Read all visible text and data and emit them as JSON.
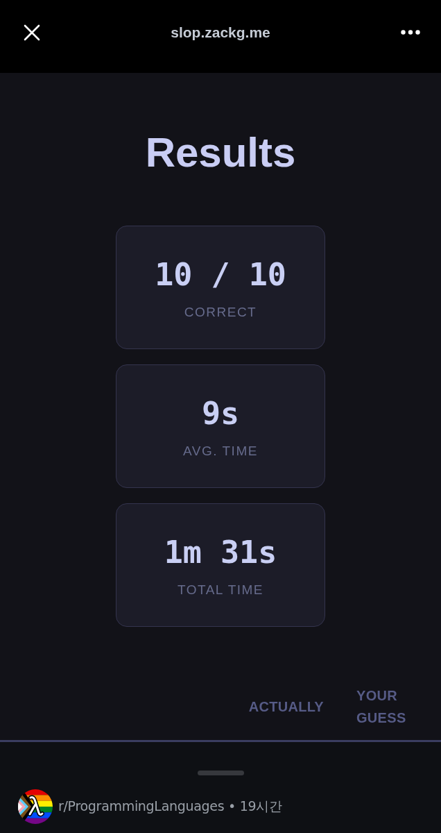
{
  "browser_bar": {
    "url": "slop.zackg.me"
  },
  "title": "Results",
  "stats": [
    {
      "value": "10 / 10",
      "label": "CORRECT"
    },
    {
      "value": "9s",
      "label": "AVG. TIME"
    },
    {
      "value": "1m 31s",
      "label": "TOTAL TIME"
    }
  ],
  "table": {
    "columns": [
      "ACTUALLY",
      "YOUR GUESS"
    ]
  },
  "post_footer": {
    "community": "r/ProgrammingLanguages",
    "separator": "•",
    "age": "19시간"
  }
}
